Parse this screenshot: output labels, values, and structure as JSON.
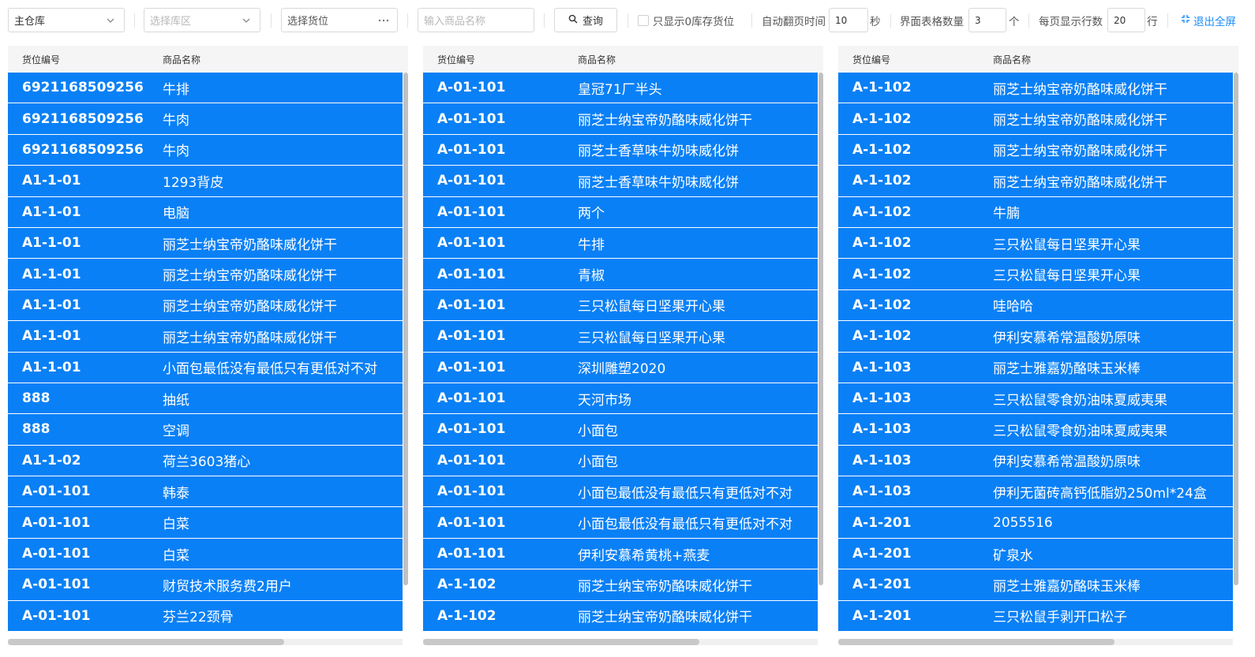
{
  "toolbar": {
    "warehouse": {
      "value": "主仓库"
    },
    "area": {
      "placeholder": "选择库区"
    },
    "location": {
      "placeholder": "选择货位"
    },
    "product": {
      "placeholder": "输入商品名称"
    },
    "query_label": "查询",
    "zero_stock_label": "只显示0库存货位",
    "auto_page_label": "自动翻页时间",
    "auto_page_value": "10",
    "auto_page_unit": "秒",
    "table_count_label": "界面表格数量",
    "table_count_value": "3",
    "table_count_unit": "个",
    "rows_per_page_label": "每页显示行数",
    "rows_per_page_value": "20",
    "rows_per_page_unit": "行",
    "exit_fullscreen_label": "退出全屏"
  },
  "tables": [
    {
      "headers": {
        "location": "货位编号",
        "product": "商品名称"
      },
      "rows": [
        {
          "location": "6921168509256",
          "product": "牛排"
        },
        {
          "location": "6921168509256",
          "product": "牛肉"
        },
        {
          "location": "6921168509256",
          "product": "牛肉"
        },
        {
          "location": "A1-1-01",
          "product": "1293背皮"
        },
        {
          "location": "A1-1-01",
          "product": "电脑"
        },
        {
          "location": "A1-1-01",
          "product": "丽芝士纳宝帝奶酪味威化饼干"
        },
        {
          "location": "A1-1-01",
          "product": "丽芝士纳宝帝奶酪味威化饼干"
        },
        {
          "location": "A1-1-01",
          "product": "丽芝士纳宝帝奶酪味威化饼干"
        },
        {
          "location": "A1-1-01",
          "product": "丽芝士纳宝帝奶酪味威化饼干"
        },
        {
          "location": "A1-1-01",
          "product": "小面包最低没有最低只有更低对不对"
        },
        {
          "location": "888",
          "product": "抽纸"
        },
        {
          "location": "888",
          "product": "空调"
        },
        {
          "location": "A1-1-02",
          "product": "荷兰3603猪心"
        },
        {
          "location": "A-01-101",
          "product": "韩泰"
        },
        {
          "location": "A-01-101",
          "product": "白菜"
        },
        {
          "location": "A-01-101",
          "product": "白菜"
        },
        {
          "location": "A-01-101",
          "product": "财贸技术服务费2用户"
        },
        {
          "location": "A-01-101",
          "product": "芬兰22颈骨"
        }
      ]
    },
    {
      "headers": {
        "location": "货位编号",
        "product": "商品名称"
      },
      "rows": [
        {
          "location": "A-01-101",
          "product": "皇冠71厂半头"
        },
        {
          "location": "A-01-101",
          "product": "丽芝士纳宝帝奶酪味威化饼干"
        },
        {
          "location": "A-01-101",
          "product": "丽芝士香草味牛奶味威化饼"
        },
        {
          "location": "A-01-101",
          "product": "丽芝士香草味牛奶味威化饼"
        },
        {
          "location": "A-01-101",
          "product": "两个"
        },
        {
          "location": "A-01-101",
          "product": "牛排"
        },
        {
          "location": "A-01-101",
          "product": "青椒"
        },
        {
          "location": "A-01-101",
          "product": "三只松鼠每日坚果开心果"
        },
        {
          "location": "A-01-101",
          "product": "三只松鼠每日坚果开心果"
        },
        {
          "location": "A-01-101",
          "product": "深圳雕塑2020"
        },
        {
          "location": "A-01-101",
          "product": "天河市场"
        },
        {
          "location": "A-01-101",
          "product": "小面包"
        },
        {
          "location": "A-01-101",
          "product": "小面包"
        },
        {
          "location": "A-01-101",
          "product": "小面包最低没有最低只有更低对不对"
        },
        {
          "location": "A-01-101",
          "product": "小面包最低没有最低只有更低对不对"
        },
        {
          "location": "A-01-101",
          "product": "伊利安慕希黄桃+燕麦"
        },
        {
          "location": "A-1-102",
          "product": "丽芝士纳宝帝奶酪味威化饼干"
        },
        {
          "location": "A-1-102",
          "product": "丽芝士纳宝帝奶酪味威化饼干"
        }
      ]
    },
    {
      "headers": {
        "location": "货位编号",
        "product": "商品名称"
      },
      "rows": [
        {
          "location": "A-1-102",
          "product": "丽芝士纳宝帝奶酪味威化饼干"
        },
        {
          "location": "A-1-102",
          "product": "丽芝士纳宝帝奶酪味威化饼干"
        },
        {
          "location": "A-1-102",
          "product": "丽芝士纳宝帝奶酪味威化饼干"
        },
        {
          "location": "A-1-102",
          "product": "丽芝士纳宝帝奶酪味威化饼干"
        },
        {
          "location": "A-1-102",
          "product": "牛腩"
        },
        {
          "location": "A-1-102",
          "product": "三只松鼠每日坚果开心果"
        },
        {
          "location": "A-1-102",
          "product": "三只松鼠每日坚果开心果"
        },
        {
          "location": "A-1-102",
          "product": "哇哈哈"
        },
        {
          "location": "A-1-102",
          "product": "伊利安慕希常温酸奶原味"
        },
        {
          "location": "A-1-103",
          "product": "丽芝士雅嘉奶酪味玉米棒"
        },
        {
          "location": "A-1-103",
          "product": "三只松鼠零食奶油味夏威夷果"
        },
        {
          "location": "A-1-103",
          "product": "三只松鼠零食奶油味夏威夷果"
        },
        {
          "location": "A-1-103",
          "product": "伊利安慕希常温酸奶原味"
        },
        {
          "location": "A-1-103",
          "product": "伊利无菌砖高钙低脂奶250ml*24盒"
        },
        {
          "location": "A-1-201",
          "product": "2055516"
        },
        {
          "location": "A-1-201",
          "product": "矿泉水"
        },
        {
          "location": "A-1-201",
          "product": "丽芝士雅嘉奶酪味玉米棒"
        },
        {
          "location": "A-1-201",
          "product": "三只松鼠手剥开口松子"
        }
      ]
    }
  ],
  "colors": {
    "row_bg": "#0a80f6",
    "accent": "#1a8cff",
    "header_bg": "#f5f5f5"
  }
}
